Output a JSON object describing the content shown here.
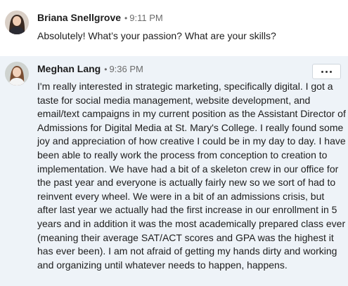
{
  "messages": [
    {
      "author": "Briana Snellgrove",
      "separator": "•",
      "time": "9:11 PM",
      "text": "Absolutely! What’s your passion? What are your skills?"
    },
    {
      "author": "Meghan Lang",
      "separator": "•",
      "time": "9:36 PM",
      "text": "I'm really interested in strategic marketing, specifically digital. I got a taste for social media management, website development, and email/text campaigns in my current position as the Assistant Director of Admissions for Digital Media at St. Mary's College. I really found some joy and appreciation of how creative I could be in my day to day. I have been able to really work the process from conception to creation to implementation. We have had a bit of a skeleton crew in our office for the past year and everyone is actually fairly new so we sort of had to reinvent every wheel. We were in a bit of an admissions crisis, but after last year we actually had the first increase in our enrollment in 5 years and in addition it was the most academically prepared class ever (meaning their average SAT/ACT scores and GPA was the highest it has ever been). I am not afraid of getting my hands dirty and working and organizing until whatever needs to happen, happens.",
      "more_icon": "more-horizontal-icon"
    }
  ]
}
